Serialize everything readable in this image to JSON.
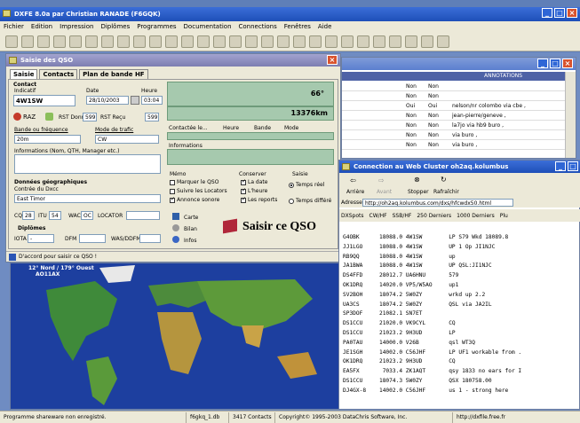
{
  "app": {
    "title": "DXFE 8.0a par Christian RANADE (F6GQK)"
  },
  "menu": [
    "Fichier",
    "Edition",
    "Impression",
    "Diplômes",
    "Programmes",
    "Documentation",
    "Connections",
    "Fenêtres",
    "Aide"
  ],
  "qso": {
    "title": "Saisie des QSO",
    "tabs": [
      "Saisie",
      "Contacts",
      "Plan de bande HF"
    ],
    "contact_label": "Contact",
    "indicatif_label": "Indicatif",
    "indicatif": "4W1SW",
    "date_label": "Date",
    "date": "28/10/2003",
    "heure_label": "Heure",
    "heure": "03:04",
    "raz": "RAZ",
    "rst_donne": "RST Donné",
    "rst_donne_val": "599",
    "rst_recu": "RST Reçu",
    "rst_recu_val": "599",
    "band_label": "Bande ou fréquence",
    "band": "20m",
    "mode_label": "Mode de trafic",
    "mode": "CW",
    "info_label": "Informations (Nom, QTH, Manager etc.)",
    "bearing": "66°",
    "distance": "13376km",
    "contact_hdrs": [
      "Contactée le...",
      "Heure",
      "Bande",
      "Mode"
    ],
    "informations": "Informations",
    "geo_label": "Données géographiques",
    "dxcc_label": "Contrée du Dxcc",
    "dxcc": "East Timor",
    "cq_label": "CQ",
    "cq": "28",
    "itu_label": "ITU",
    "itu": "54",
    "wac_label": "WAC",
    "wac": "OC",
    "locator_label": "LOCATOR",
    "diplomes_label": "Diplômes",
    "iota_label": "IOTA",
    "iota": "-",
    "dfm_label": "DFM",
    "was_label": "WAS/DDFM",
    "memo_label": "Mémo",
    "memo_items": [
      "Marquer le QSO",
      "Suivre les Locators",
      "Annonce sonore"
    ],
    "conserver_label": "Conserver",
    "conserver_items": [
      "La date",
      "L'heure",
      "Les reports"
    ],
    "saisie_label": "Saisie",
    "saisie_items": [
      "Temps réel",
      "Temps différé"
    ],
    "carte": "Carte",
    "bilan": "Bilan",
    "infos": "Infos",
    "saisir": "Saisir ce QSO",
    "status": "D'accord pour saisir ce QSO !"
  },
  "map": {
    "coords": "12° Nord / 179° Ouest",
    "locator": "AO11AX"
  },
  "log": {
    "headers": [
      "",
      "",
      "",
      "",
      "ANNOTATIONS"
    ],
    "rows": [
      {
        "a": "Non",
        "b": "Non",
        "c": ""
      },
      {
        "a": "Non",
        "b": "Non",
        "c": ""
      },
      {
        "a": "Oui",
        "b": "Oui",
        "c": "nelson/nr colombo via cbe ,"
      },
      {
        "a": "Non",
        "b": "Non",
        "c": "jean-pierre/geneve ,"
      },
      {
        "a": "Non",
        "b": "Non",
        "c": "la7jo via hb9 buro ,"
      },
      {
        "a": "Non",
        "b": "Non",
        "c": "via buro ,"
      },
      {
        "a": "Non",
        "b": "Non",
        "c": "via buro ,"
      }
    ]
  },
  "cluster": {
    "title": "Connection au Web Cluster oh2aq.kolumbus",
    "buttons": [
      "Arrière",
      "Avant",
      "Stopper",
      "Rafraîchir"
    ],
    "address_label": "Adresse",
    "address": "http://oh2aq.kolumbus.com/dxs/hfcwdx50.html",
    "links": [
      "DXSpots",
      "CW/HF",
      "SSB/HF",
      "250 Derniers",
      "1000 Derniers",
      "Plu"
    ],
    "spots": [
      "G4OBK      18088.0 4W1SW        LP S79 Wkd 18089.8",
      "JJ1LGO     18088.0 4W1SW        UP 1 Op JI1NJC",
      "RB9QQ      18088.0 4W1SW        up",
      "JA1BWA     18088.0 4W1SW        UP QSL:JI1NJC",
      "DS4FFD     28012.7 UA6HNU       579",
      "OK1DRQ     14020.0 VP5/W5AO     up1",
      "SV2BOH     18074.2 5W0ZY        wrkd up 2.2",
      "UA3CS      18074.2 5W0ZY        QSL via JA2IL",
      "SP3DOF     21082.1 SN7ET",
      "DS1CCU     21020.0 VK9CYL       CQ",
      "DS1CCU     21023.2 9H3UD        LP",
      "PA0TAU     14000.0 V26B         qsl WT3Q",
      "JE1SGH     14002.0 C56JHF       LP UF1 workable from .",
      "OK1DRQ     21023.2 9H3UD        CQ",
      "EA5FX       7033.4 ZK1AQT       qsy 1833 no ears for I",
      "DS1CCU     18074.3 5W0ZY        QSX 180758.00",
      "DJ4GX-8    14002.0 C56JHF       us 1 - strong here"
    ]
  },
  "statusbar": {
    "shareware": "Programme shareware non enregistré.",
    "db": "f6gkq_1.db",
    "contacts": "3417 Contacts",
    "copyright": "Copyright© 1995-2003 DataChris Software, Inc.",
    "url": "http://dxfile.free.fr"
  },
  "colors": {
    "title_blue": "#2a5fd0",
    "dialog_title": "#8e8fbf",
    "green_panel": "#a6c9ae",
    "map_sea": "#1c3fa0"
  }
}
